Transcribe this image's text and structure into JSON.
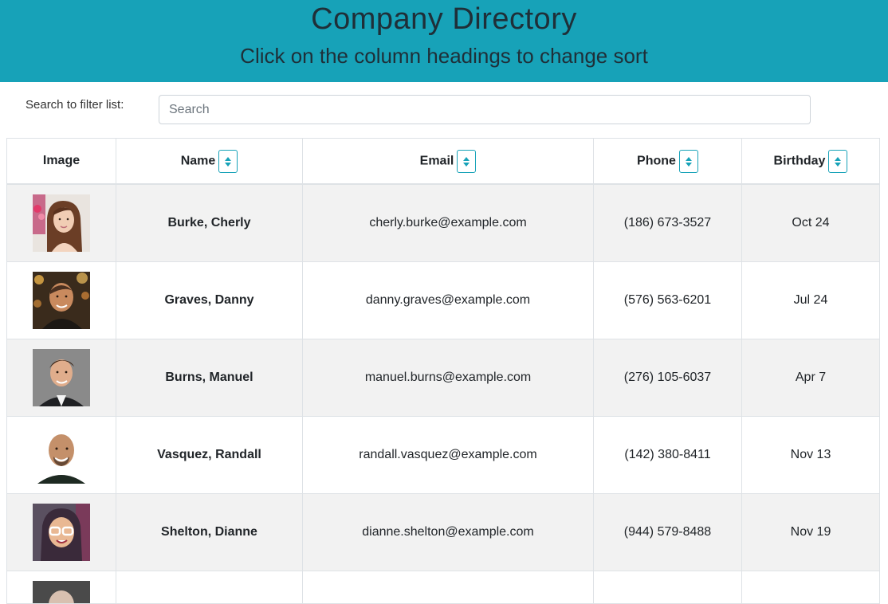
{
  "header": {
    "title": "Company Directory",
    "subtitle": "Click on the column headings to change sort"
  },
  "search": {
    "label": "Search to filter list:",
    "placeholder": "Search",
    "value": ""
  },
  "table": {
    "columns": [
      "Image",
      "Name",
      "Email",
      "Phone",
      "Birthday"
    ],
    "sortable": [
      "Name",
      "Email",
      "Phone",
      "Birthday"
    ],
    "accent_color": "#17a2b8",
    "rows": [
      {
        "name": "Burke, Cherly",
        "email": "cherly.burke@example.com",
        "phone": "(186) 673-3527",
        "birthday": "Oct 24",
        "avatar": "avatar-woman-long-brown-hair"
      },
      {
        "name": "Graves, Danny",
        "email": "danny.graves@example.com",
        "phone": "(576) 563-6201",
        "birthday": "Jul 24",
        "avatar": "avatar-man-night-lights"
      },
      {
        "name": "Burns, Manuel",
        "email": "manuel.burns@example.com",
        "phone": "(276) 105-6037",
        "birthday": "Apr 7",
        "avatar": "avatar-man-suit"
      },
      {
        "name": "Vasquez, Randall",
        "email": "randall.vasquez@example.com",
        "phone": "(142) 380-8411",
        "birthday": "Nov 13",
        "avatar": "avatar-man-bald-smiling"
      },
      {
        "name": "Shelton, Dianne",
        "email": "dianne.shelton@example.com",
        "phone": "(944) 579-8488",
        "birthday": "Nov 19",
        "avatar": "avatar-woman-glasses"
      }
    ]
  }
}
